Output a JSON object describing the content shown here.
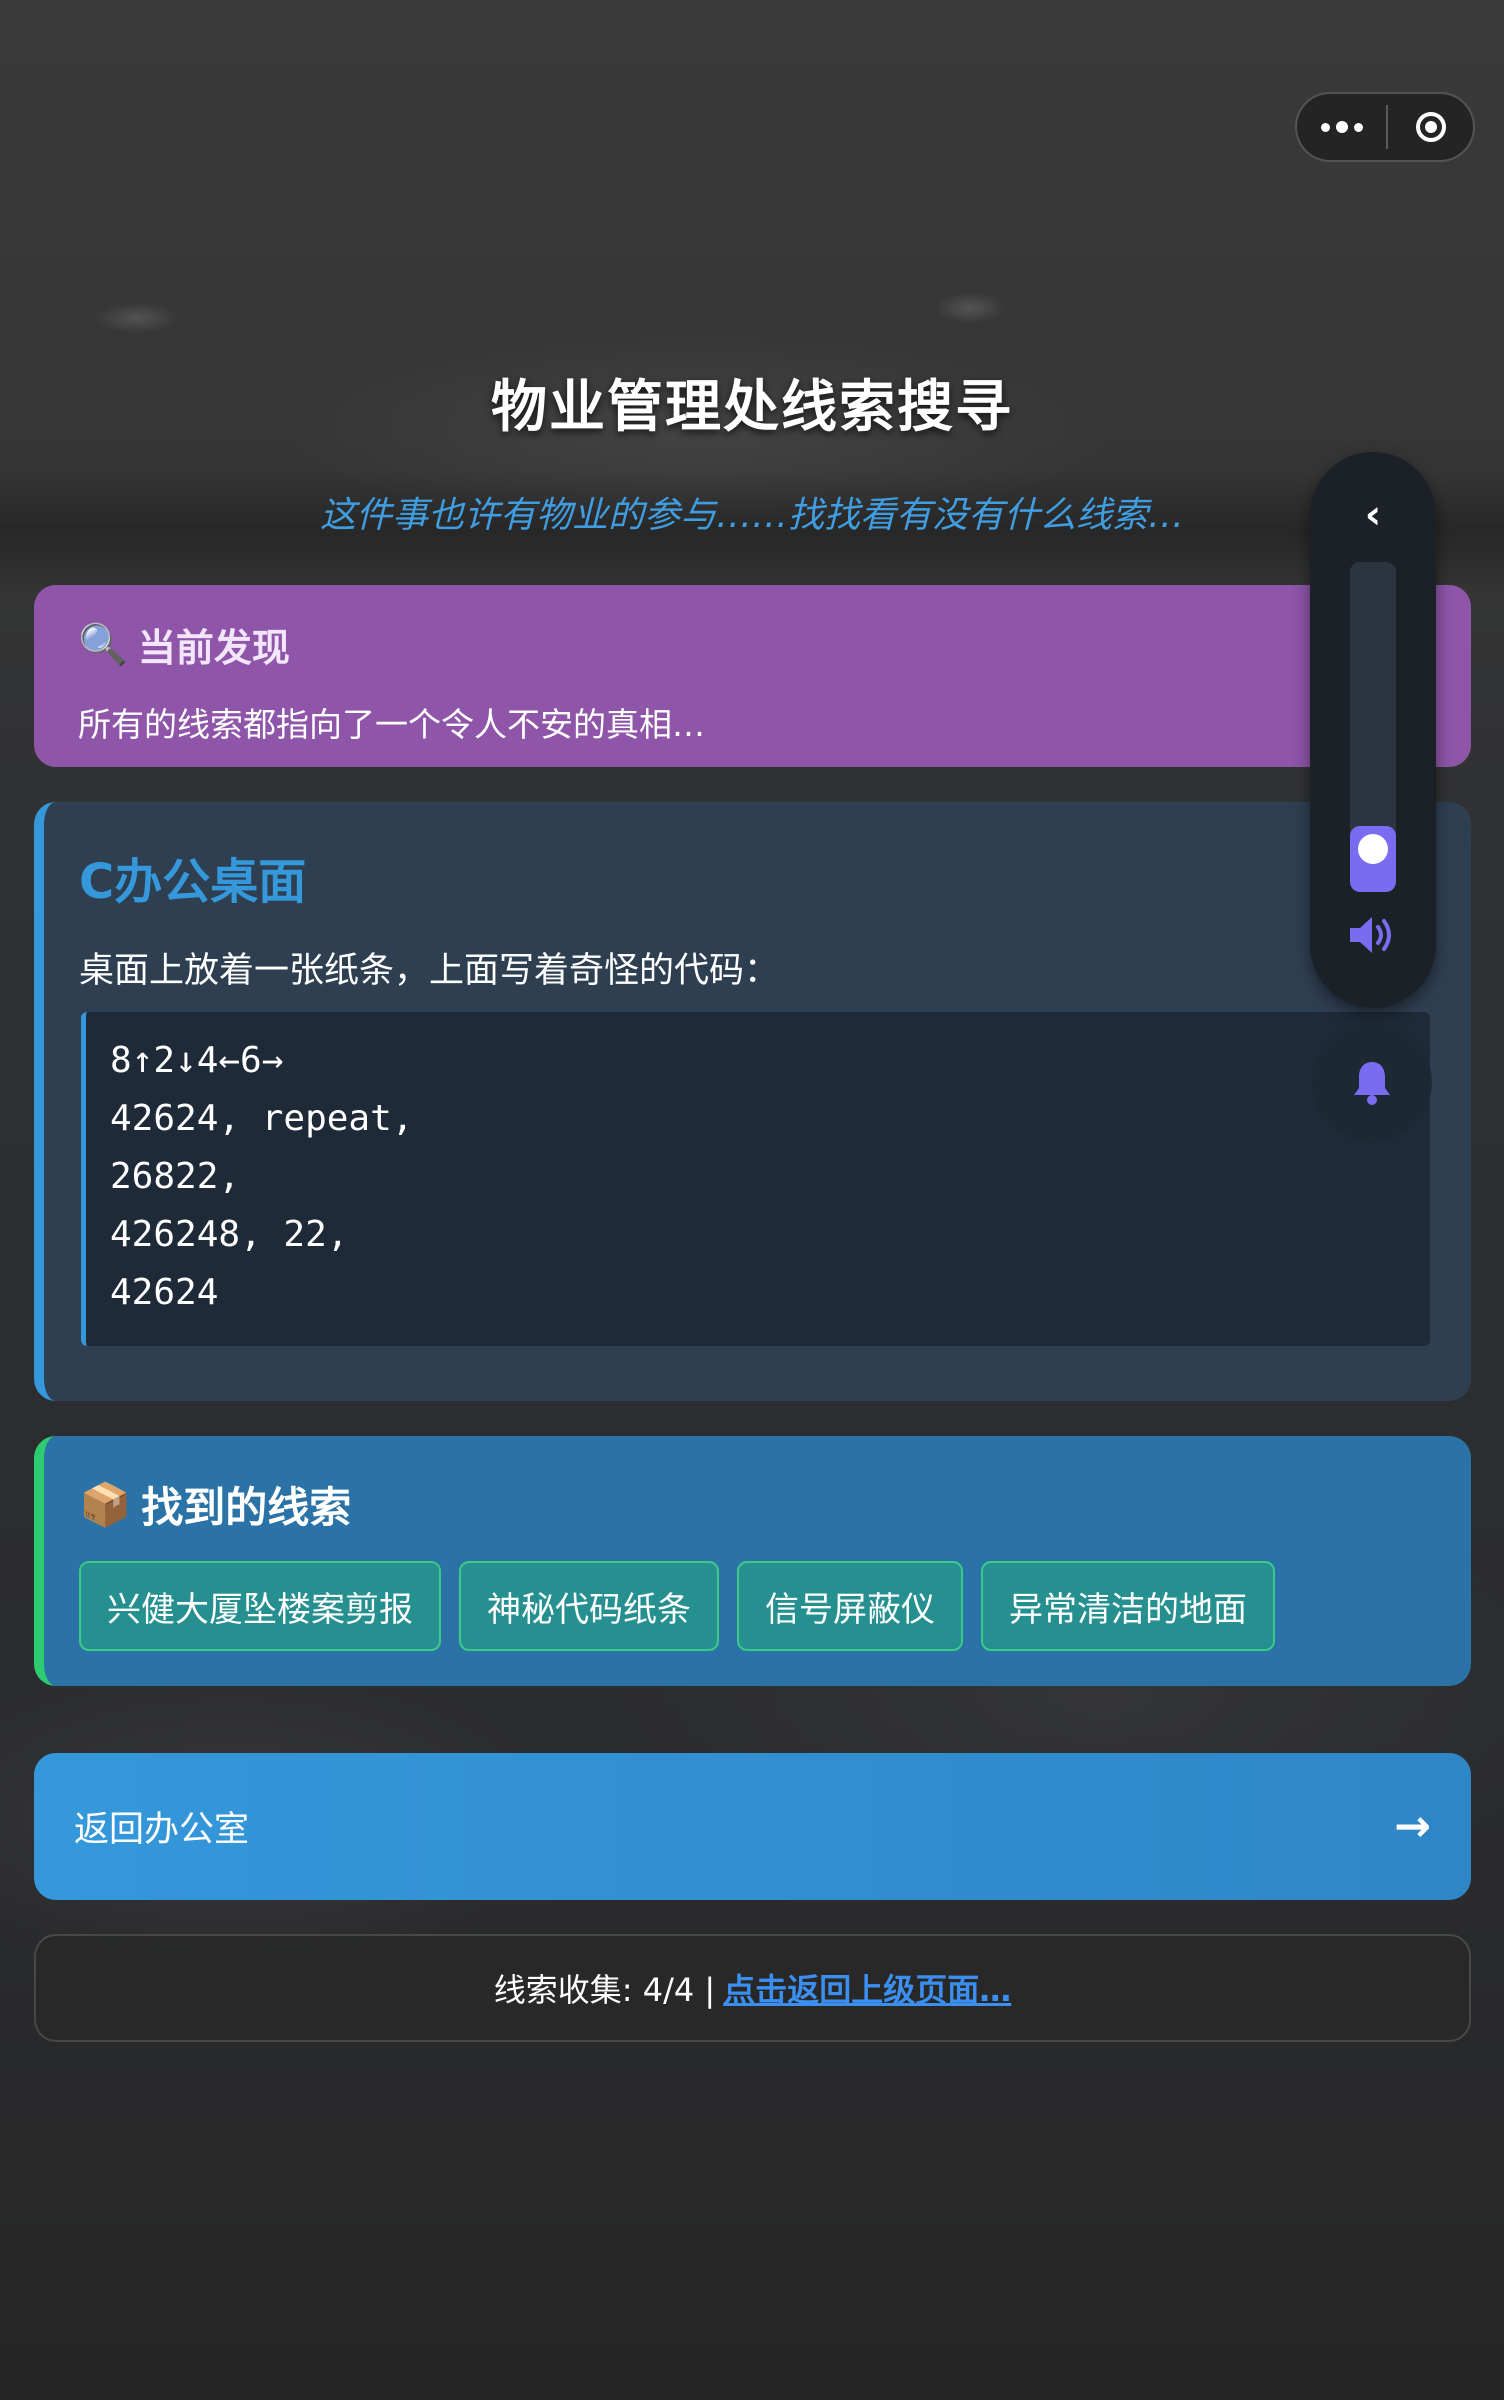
{
  "header": {
    "title": "物业管理处线索搜寻",
    "subtitle": "这件事也许有物业的参与……找找看有没有什么线索…"
  },
  "discovery": {
    "icon": "🔍",
    "title": "当前发现",
    "text": "所有的线索都指向了一个令人不安的真相…"
  },
  "desk": {
    "title": "C办公桌面",
    "description": "桌面上放着一张纸条，上面写着奇怪的代码：",
    "code_lines": [
      "8↑2↓4←6→",
      "42624, repeat,",
      "26822,",
      "426248, 22,",
      "42624"
    ]
  },
  "clues": {
    "icon": "📦",
    "title": "找到的线索",
    "items": [
      "兴健大厦坠楼案剪报",
      "神秘代码纸条",
      "信号屏蔽仪",
      "异常清洁的地面"
    ]
  },
  "return_button": {
    "label": "返回办公室",
    "arrow": "→"
  },
  "footer": {
    "progress": "线索收集: 4/4 |",
    "link": "点击返回上级页面…"
  },
  "volume": {
    "collapse_icon": "‹",
    "level": 0.2
  },
  "colors": {
    "accent_blue": "#3498db",
    "discovery_purple": "#8e55a9",
    "clue_green": "#2ecc71",
    "volume_purple": "#7a6cf0"
  },
  "icons": [
    "more-icon",
    "close-icon",
    "magnifier-icon",
    "package-icon",
    "arrow-right-icon",
    "chevron-left-icon",
    "speaker-icon",
    "bell-icon"
  ]
}
